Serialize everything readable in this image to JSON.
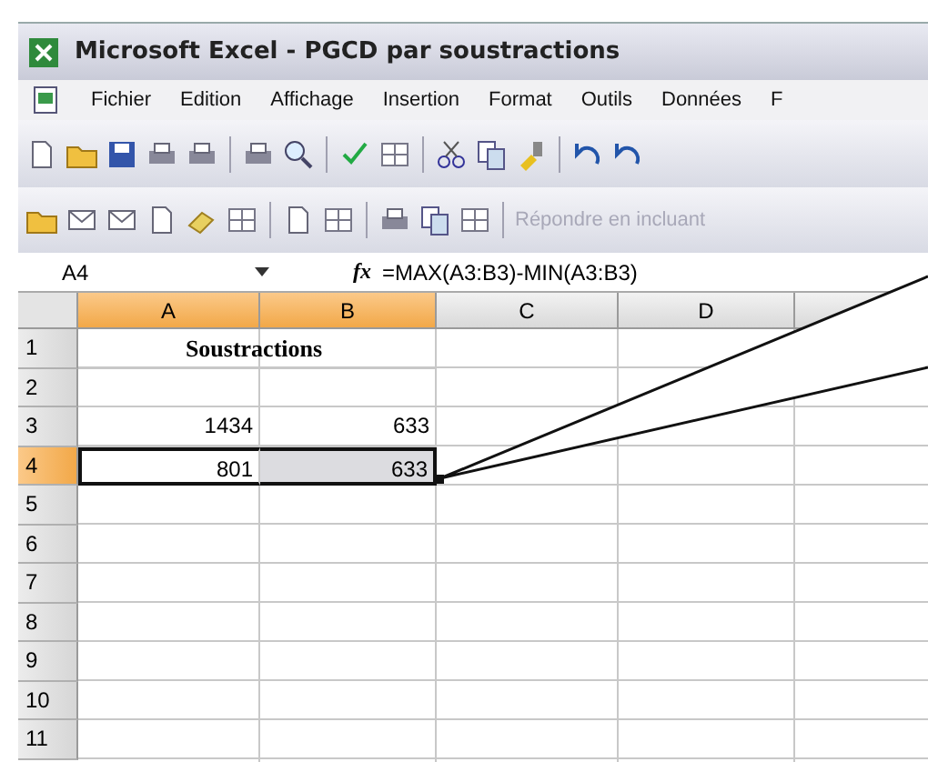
{
  "window": {
    "title": "Microsoft Excel - PGCD par soustractions"
  },
  "menu": [
    {
      "label": "Fichier"
    },
    {
      "label": "Edition"
    },
    {
      "label": "Affichage"
    },
    {
      "label": "Insertion"
    },
    {
      "label": "Format"
    },
    {
      "label": "Outils"
    },
    {
      "label": "Données"
    },
    {
      "label": "F"
    }
  ],
  "reply_toolbar": {
    "label": "Répondre en incluant",
    "disabled": true
  },
  "formula_bar": {
    "name_box": "A4",
    "fx": "fx",
    "formula": "=MAX(A3:B3)-MIN(A3:B3)"
  },
  "sheet": {
    "columns": [
      {
        "label": "A",
        "selected": true
      },
      {
        "label": "B",
        "selected": true
      },
      {
        "label": "C",
        "selected": false
      },
      {
        "label": "D",
        "selected": false
      },
      {
        "selected": false
      }
    ],
    "rows": [
      {
        "label": "1",
        "selected": false,
        "title": "Soustractions",
        "cells": []
      },
      {
        "label": "2",
        "selected": false,
        "cells": []
      },
      {
        "label": "3",
        "selected": false,
        "cells": [
          {
            "value": "1434",
            "selected": false,
            "active": false
          },
          {
            "value": "633",
            "selected": false,
            "active": false
          }
        ]
      },
      {
        "label": "4",
        "selected": true,
        "cells": [
          {
            "value": "801",
            "selected": true,
            "active": true
          },
          {
            "value": "633",
            "selected": true,
            "active": false
          }
        ]
      },
      {
        "label": "5",
        "selected": false,
        "cells": []
      },
      {
        "label": "6",
        "selected": false,
        "cells": []
      },
      {
        "label": "7",
        "selected": false,
        "cells": []
      },
      {
        "label": "8",
        "selected": false,
        "cells": []
      },
      {
        "label": "9",
        "selected": false,
        "cells": []
      },
      {
        "label": "10",
        "selected": false,
        "cells": []
      },
      {
        "label": "11",
        "selected": false,
        "cells": []
      }
    ]
  }
}
